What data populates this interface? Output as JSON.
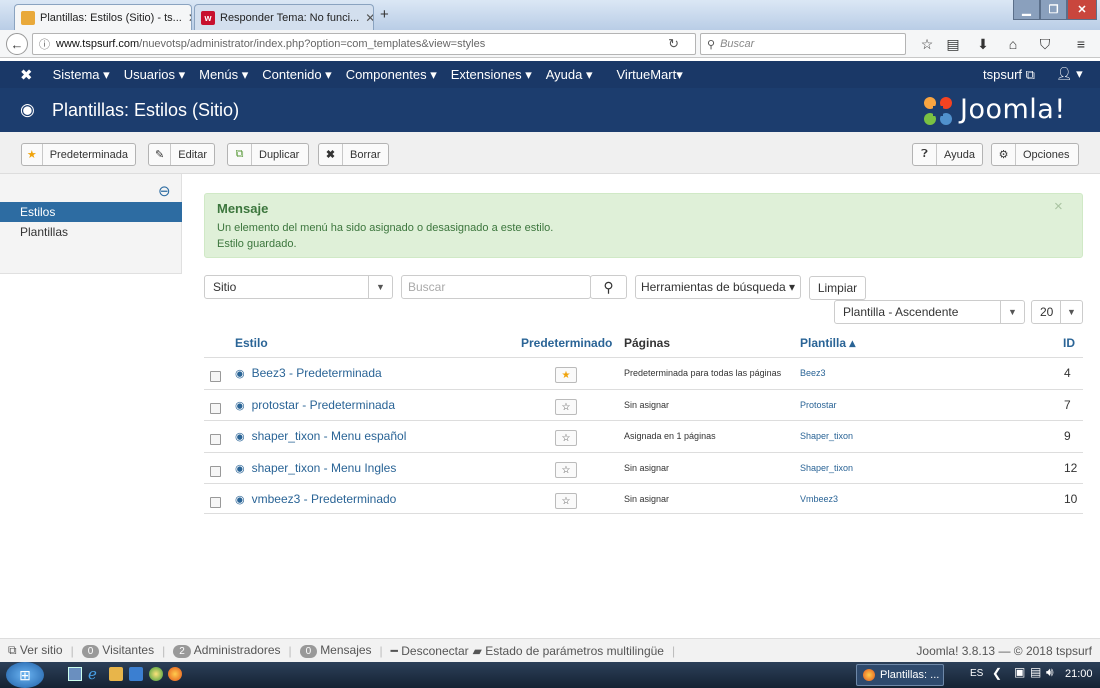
{
  "browser": {
    "tabs": [
      {
        "title": "Plantillas: Estilos (Sitio) - ts...",
        "active": true
      },
      {
        "title": "Responder Tema: No funci...",
        "active": false
      }
    ],
    "new_tab": "+",
    "url_host": "www.tspsurf.com",
    "url_path": "/nuevotsp/administrator/index.php?option=com_templates&view=styles",
    "search_placeholder": "Buscar"
  },
  "joomla_menu": {
    "items": [
      "Sistema ▾",
      "Usuarios ▾",
      "Menús ▾",
      "Contenido ▾",
      "Componentes ▾",
      "Extensiones ▾",
      "Ayuda ▾",
      "VirtueMart▾"
    ],
    "site_link": "tspsurf ⧉",
    "user": "▾"
  },
  "header": {
    "title": "Plantillas: Estilos (Sitio)",
    "logo": "Joomla!"
  },
  "toolbar": {
    "default": "Predeterminada",
    "edit": "Editar",
    "duplicate": "Duplicar",
    "delete": "Borrar",
    "help": "Ayuda",
    "options": "Opciones"
  },
  "sidebar": {
    "items": [
      {
        "label": "Estilos",
        "active": true
      },
      {
        "label": "Plantillas",
        "active": false
      }
    ]
  },
  "message": {
    "heading": "Mensaje",
    "line1": "Un elemento del menú ha sido asignado o desasignado a este estilo.",
    "line2": "Estilo guardado.",
    "close": "×"
  },
  "filters": {
    "client": "Sitio",
    "search_placeholder": "Buscar",
    "search_tools": "Herramientas de búsqueda ▾",
    "clear": "Limpiar",
    "ordering": "Plantilla - Ascendente",
    "limit": "20"
  },
  "table": {
    "headers": {
      "style": "Estilo",
      "default": "Predeterminado",
      "pages": "Páginas",
      "template": "Plantilla ▴",
      "id": "ID"
    },
    "rows": [
      {
        "style": "Beez3 - Predeterminada",
        "is_default": true,
        "pages": "Predeterminada para todas las páginas",
        "template": "Beez3",
        "id": "4"
      },
      {
        "style": "protostar - Predeterminada",
        "is_default": false,
        "pages": "Sin asignar",
        "template": "Protostar",
        "id": "7"
      },
      {
        "style": "shaper_tixon - Menu español",
        "is_default": false,
        "pages": "Asignada en 1 páginas",
        "template": "Shaper_tixon",
        "id": "9"
      },
      {
        "style": "shaper_tixon - Menu Ingles",
        "is_default": false,
        "pages": "Sin asignar",
        "template": "Shaper_tixon",
        "id": "12"
      },
      {
        "style": "vmbeez3 - Predeterminado",
        "is_default": false,
        "pages": "Sin asignar",
        "template": "Vmbeez3",
        "id": "10"
      }
    ]
  },
  "statusbar": {
    "view_site": "Ver sitio",
    "visitors_count": "0",
    "visitors": "Visitantes",
    "admins_count": "2",
    "admins": "Administradores",
    "messages_count": "0",
    "messages": "Mensajes",
    "logout": "Desconectar",
    "multilang": "Estado de parámetros multilingüe",
    "version": "Joomla! 3.8.13 — © 2018 tspsurf"
  },
  "taskbar": {
    "task": "Plantillas: ...",
    "lang": "ES",
    "time": "21:00"
  },
  "colors": {
    "joomla_nav": "#1a3867",
    "joomla_header": "#1c3d6e",
    "sidebar_active": "#2d6ca2",
    "message_bg": "#dff0d8",
    "message_text": "#3c763d",
    "link": "#2a6496",
    "star_gold": "#f0a30a"
  }
}
